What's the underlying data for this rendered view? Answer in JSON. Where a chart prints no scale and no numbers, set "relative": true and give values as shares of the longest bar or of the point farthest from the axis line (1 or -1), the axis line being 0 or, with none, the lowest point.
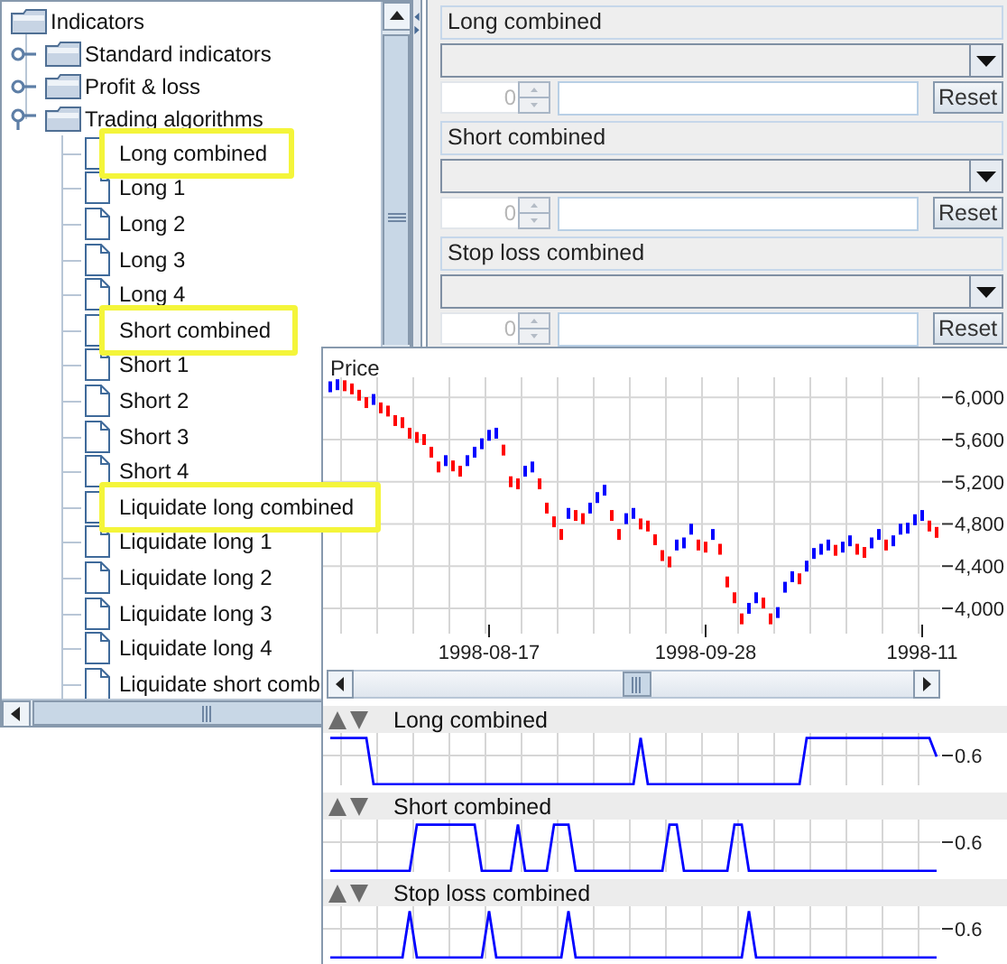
{
  "tree": {
    "label": "Indicators",
    "children": [
      {
        "label": "Standard indicators",
        "expanded": false
      },
      {
        "label": "Profit & loss",
        "expanded": false
      },
      {
        "label": "Trading algorithms",
        "expanded": true,
        "children": [
          {
            "label": "Long combined",
            "highlighted": true
          },
          {
            "label": "Long 1",
            "highlighted": false
          },
          {
            "label": "Long 2",
            "highlighted": false
          },
          {
            "label": "Long 3",
            "highlighted": false
          },
          {
            "label": "Long 4",
            "highlighted": false
          },
          {
            "label": "Short combined",
            "highlighted": true
          },
          {
            "label": "Short 1",
            "highlighted": false
          },
          {
            "label": "Short 2",
            "highlighted": false
          },
          {
            "label": "Short 3",
            "highlighted": false
          },
          {
            "label": "Short 4",
            "highlighted": false
          },
          {
            "label": "Liquidate long combined",
            "highlighted": true
          },
          {
            "label": "Liquidate long 1",
            "highlighted": false
          },
          {
            "label": "Liquidate long 2",
            "highlighted": false
          },
          {
            "label": "Liquidate long 3",
            "highlighted": false
          },
          {
            "label": "Liquidate long 4",
            "highlighted": false
          },
          {
            "label": "Liquidate short comb",
            "highlighted": false
          }
        ]
      }
    ]
  },
  "settings": [
    {
      "title": "Long combined",
      "spinner": {
        "value": "0",
        "disabled": true
      },
      "reset_button": "Reset"
    },
    {
      "title": "Short combined",
      "spinner": {
        "value": "0",
        "disabled": true
      },
      "reset_button": "Reset"
    },
    {
      "title": "Stop loss combined",
      "spinner": {
        "value": "0",
        "disabled": true
      },
      "reset_button": "Reset"
    }
  ],
  "price_chart": {
    "chart_data": {
      "type": "scatter",
      "title": "Price",
      "grid": true,
      "ylim": [
        3760,
        6190
      ],
      "yticks": [
        {
          "value": 6000,
          "label": "6,000"
        },
        {
          "value": 5600,
          "label": "5,600"
        },
        {
          "value": 5200,
          "label": "5,200"
        },
        {
          "value": 4800,
          "label": "4,800"
        },
        {
          "value": 4400,
          "label": "4,400"
        },
        {
          "value": 4000,
          "label": "4,000"
        }
      ],
      "categories": [
        null,
        null,
        null,
        null,
        null,
        null,
        null,
        null,
        null,
        null,
        null,
        null,
        null,
        null,
        null,
        null,
        null,
        null,
        null,
        null,
        null,
        null,
        "1998-08-17",
        null,
        null,
        null,
        null,
        null,
        null,
        null,
        null,
        null,
        null,
        null,
        null,
        null,
        null,
        null,
        null,
        null,
        null,
        null,
        null,
        null,
        null,
        null,
        null,
        null,
        null,
        null,
        null,
        null,
        "1998-09-28",
        null,
        null,
        null,
        null,
        null,
        null,
        null,
        null,
        null,
        null,
        null,
        null,
        null,
        null,
        null,
        null,
        null,
        null,
        null,
        null,
        null,
        null,
        null,
        null,
        null,
        null,
        null,
        null,
        null,
        "1998-11",
        null,
        null
      ],
      "series": [
        {
          "values": [
            6100,
            6120,
            6110,
            6080,
            6020,
            5950,
            5980,
            5900,
            5870,
            5780,
            5760,
            5660,
            5620,
            5600,
            5480,
            5340,
            5400,
            5350,
            5300,
            5400,
            5480,
            5560,
            5640,
            5660,
            5500,
            5200,
            5180,
            5300,
            5340,
            5180,
            4950,
            4820,
            4700,
            4900,
            4880,
            4850,
            4950,
            5050,
            5120,
            4880,
            4700,
            4850,
            4900,
            4800,
            4780,
            4650,
            4500,
            4440,
            4600,
            4620,
            4750,
            4600,
            4580,
            4700,
            4560,
            4250,
            4100,
            3900,
            4000,
            4100,
            4050,
            3900,
            3960,
            4200,
            4300,
            4280,
            4400,
            4520,
            4560,
            4600,
            4550,
            4580,
            4640,
            4560,
            4530,
            4620,
            4700,
            4600,
            4640,
            4750,
            4760,
            4840,
            4880,
            4780,
            4720
          ]
        }
      ]
    }
  },
  "indicator_strips": [
    {
      "chart_data": {
        "type": "line",
        "title": "Long combined",
        "relative": true,
        "annotations": [
          "0.6"
        ],
        "series": [
          {
            "color": "#0000ff",
            "values": [
              1,
              1,
              1,
              1,
              1,
              1,
              0,
              0,
              0,
              0,
              0,
              0,
              0,
              0,
              0,
              0,
              0,
              0,
              0,
              0,
              0,
              0,
              0,
              0,
              0,
              0,
              0,
              0,
              0,
              0,
              0,
              0,
              0,
              0,
              0,
              0,
              0,
              0,
              0,
              0,
              0,
              0,
              0,
              1,
              0,
              0,
              0,
              0,
              0,
              0,
              0,
              0,
              0,
              0,
              0,
              0,
              0,
              0,
              0,
              0,
              0,
              0,
              0,
              0,
              0,
              0,
              1,
              1,
              1,
              1,
              1,
              1,
              1,
              1,
              1,
              1,
              1,
              1,
              1,
              1,
              1,
              1,
              1,
              1,
              0.6
            ]
          }
        ]
      }
    },
    {
      "chart_data": {
        "type": "line",
        "title": "Short combined",
        "relative": true,
        "annotations": [
          "0.6"
        ],
        "series": [
          {
            "color": "#0000ff",
            "values": [
              0,
              0,
              0,
              0,
              0,
              0,
              0,
              0,
              0,
              0,
              0,
              0,
              1,
              1,
              1,
              1,
              1,
              1,
              1,
              1,
              1,
              0,
              0,
              0,
              0,
              0,
              1,
              0,
              0,
              0,
              0,
              1,
              1,
              1,
              0,
              0,
              0,
              0,
              0,
              0,
              0,
              0,
              0,
              0,
              0,
              0,
              0,
              1,
              1,
              0,
              0,
              0,
              0,
              0,
              0,
              0,
              1,
              1,
              0,
              0,
              0,
              0,
              0,
              0,
              0,
              0,
              0,
              0,
              0,
              0,
              0,
              0,
              0,
              0,
              0,
              0,
              0,
              0,
              0,
              0,
              0,
              0,
              0,
              0,
              0
            ]
          }
        ]
      }
    },
    {
      "chart_data": {
        "type": "line",
        "title": "Stop loss combined",
        "relative": true,
        "annotations": [
          "0.6"
        ],
        "series": [
          {
            "color": "#0000ff",
            "values": [
              0,
              0,
              0,
              0,
              0,
              0,
              0,
              0,
              0,
              0,
              0,
              1,
              0,
              0,
              0,
              0,
              0,
              0,
              0,
              0,
              0,
              0,
              1,
              0,
              0,
              0,
              0,
              0,
              0,
              0,
              0,
              0,
              0,
              1,
              0,
              0,
              0,
              0,
              0,
              0,
              0,
              0,
              0,
              0,
              0,
              0,
              0,
              0,
              0,
              0,
              0,
              0,
              0,
              0,
              0,
              0,
              0,
              0,
              1,
              0,
              0,
              0,
              0,
              0,
              0,
              0,
              0,
              0,
              0,
              0,
              0,
              0,
              0,
              0,
              0,
              0,
              0,
              0,
              0,
              0,
              0,
              0,
              0,
              0,
              0
            ]
          }
        ]
      }
    }
  ]
}
